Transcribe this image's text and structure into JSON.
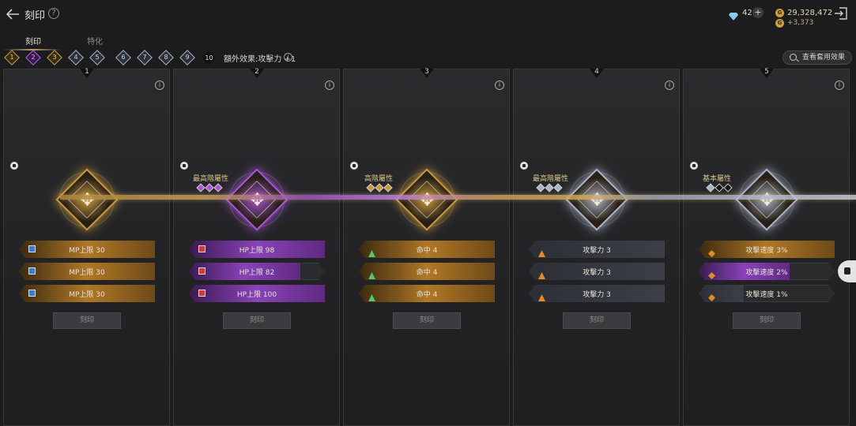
{
  "header": {
    "title": "刻印",
    "gem_count": "42",
    "gem_plus": "+",
    "gold": "29,328,472",
    "gold_delta": "+3,373",
    "coin_glyph": "G"
  },
  "tabs": [
    {
      "label": "刻印",
      "active": true
    },
    {
      "label": "特化",
      "active": false
    }
  ],
  "level_track": {
    "levels": [
      "1",
      "2",
      "3",
      "4",
      "5",
      "6",
      "7",
      "8",
      "9"
    ],
    "max_label": "10",
    "bonus_text": "額外效果:攻擊力 +1"
  },
  "view_button": "查看套用效果",
  "panels": [
    {
      "number": "1",
      "attr_title": "",
      "color": "#c99a3e",
      "stats": [
        {
          "text": "MP上限 30",
          "fill": 1.0
        },
        {
          "text": "MP上限 30",
          "fill": 1.0
        },
        {
          "text": "MP上限 30",
          "fill": 1.0
        }
      ],
      "button": "刻印"
    },
    {
      "number": "2",
      "attr_title": "最高階屬性",
      "color": "#a955d6",
      "stats": [
        {
          "text": "HP上限 98",
          "fill": 1.0
        },
        {
          "text": "HP上限 82",
          "fill": 0.82
        },
        {
          "text": "HP上限 100",
          "fill": 1.0
        }
      ],
      "button": "刻印"
    },
    {
      "number": "3",
      "attr_title": "高階屬性",
      "color": "#c99a3e",
      "stats": [
        {
          "text": "命中 4",
          "fill": 1.0
        },
        {
          "text": "命中 4",
          "fill": 1.0
        },
        {
          "text": "命中 4",
          "fill": 1.0
        }
      ],
      "button": "刻印"
    },
    {
      "number": "4",
      "attr_title": "最高階屬性",
      "color": "#aab4c6",
      "stats": [
        {
          "text": "攻擊力 3",
          "fill": 1.0
        },
        {
          "text": "攻擊力 3",
          "fill": 1.0
        },
        {
          "text": "攻擊力 3",
          "fill": 1.0
        }
      ],
      "button": "刻印"
    },
    {
      "number": "5",
      "attr_title": "基本屬性",
      "color": "#aab4c6",
      "stats": [
        {
          "text": "攻擊速度 3%",
          "fill": 1.0
        },
        {
          "text": "攻擊速度 2%",
          "fill": 0.67
        },
        {
          "text": "攻擊速度 1%",
          "fill": 0.33
        }
      ],
      "button": "刻印"
    }
  ]
}
